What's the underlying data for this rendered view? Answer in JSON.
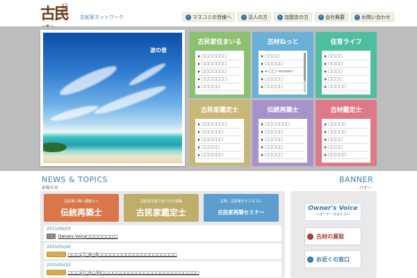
{
  "header": {
    "logo_text": "古民家",
    "logo_en": "KOMINKA NETWORK",
    "subtitle": "古民家ネットワーク",
    "nav": [
      {
        "label": "マスコミの皆様へ",
        "icon": "arrow-circle-icon"
      },
      {
        "label": "法人の方",
        "icon": "arrow-circle-icon"
      },
      {
        "label": "加盟店の方",
        "icon": "arrow-circle-icon"
      },
      {
        "label": "会社概要",
        "icon": "arrow-circle-icon"
      },
      {
        "label": "お問い合わせ",
        "icon": "arrow-circle-icon"
      }
    ]
  },
  "hero": {
    "caption": "波の音"
  },
  "cards": [
    {
      "title": "古民家住まいる",
      "color": "#8dc172",
      "items": [
        "□□□□□□□",
        "□□□□□□□",
        "□□□□□□□",
        "□□□□□□□",
        "□□□□□"
      ]
    },
    {
      "title": "古材ねっと",
      "color": "#6ab1d8",
      "items": [
        "□□□□",
        "□□□□□",
        "e-□□~ecozai~",
        "□□□□□",
        "□□□□□"
      ]
    },
    {
      "title": "住育ライフ",
      "color": "#4dbfa0",
      "items": [
        "□□□□",
        "□□□□",
        "□□□□",
        "□□□□",
        "□□□□□"
      ]
    },
    {
      "title": "古民家鑑定士",
      "color": "#c9b777",
      "items": [
        "□□□□□□□",
        "□□□□□□",
        "□□□□□□",
        "□□□□□",
        "□□□□□□"
      ]
    },
    {
      "title": "伝統再築士",
      "color": "#a793c9",
      "items": [
        "□□□□□□□",
        "□□□□□",
        "□□□□□",
        "□□□□□",
        "□□□□□"
      ]
    },
    {
      "title": "古材鑑定士",
      "color": "#e07888",
      "items": [
        "□□□□□",
        "□□□□□",
        "□□□□",
        "□□□□",
        "□□□□□"
      ]
    }
  ],
  "news": {
    "title": "NEWS & TOPICS",
    "subtitle": "お知らせ",
    "categories": [
      {
        "small": "古民家に稼い建築士へ",
        "big": "伝統再築士",
        "color": "#d9764a"
      },
      {
        "small": "古民家を取り扱う方の資格",
        "big": "古民家鑑定士",
        "color": "#bfae6a"
      },
      {
        "small": "古材・古民家をビジネスに",
        "big": "古民家再築セミナー",
        "color": "#5c9fcf"
      }
    ],
    "items": [
      {
        "date": "2015/06/03",
        "tag": "□□",
        "tag_color": "#777",
        "text": "Owners Voice□□□□□□□□"
      },
      {
        "date": "2015/05/26",
        "tag": "□□□□□",
        "tag_color": "#d49a36",
        "text": "□□□27□6□6□□□□□□□□□□□□□□□□□□□□"
      },
      {
        "date": "2015/05/22",
        "tag": "□□□□□",
        "tag_color": "#d49a36",
        "text": "□□□27□5□30□□□□□□□□□□□□□□□□□□□□□□□□□"
      }
    ]
  },
  "banner": {
    "title": "BANNER",
    "subtitle": "バナー",
    "owners_voice": "Owner's Voice",
    "owners_voice_sub": "〜オーナーズボイス〜",
    "items": [
      {
        "label": "古材の買取",
        "icon": "arrow-icon"
      },
      {
        "label": "お近くの窓口",
        "icon": "arrow-icon"
      }
    ]
  }
}
